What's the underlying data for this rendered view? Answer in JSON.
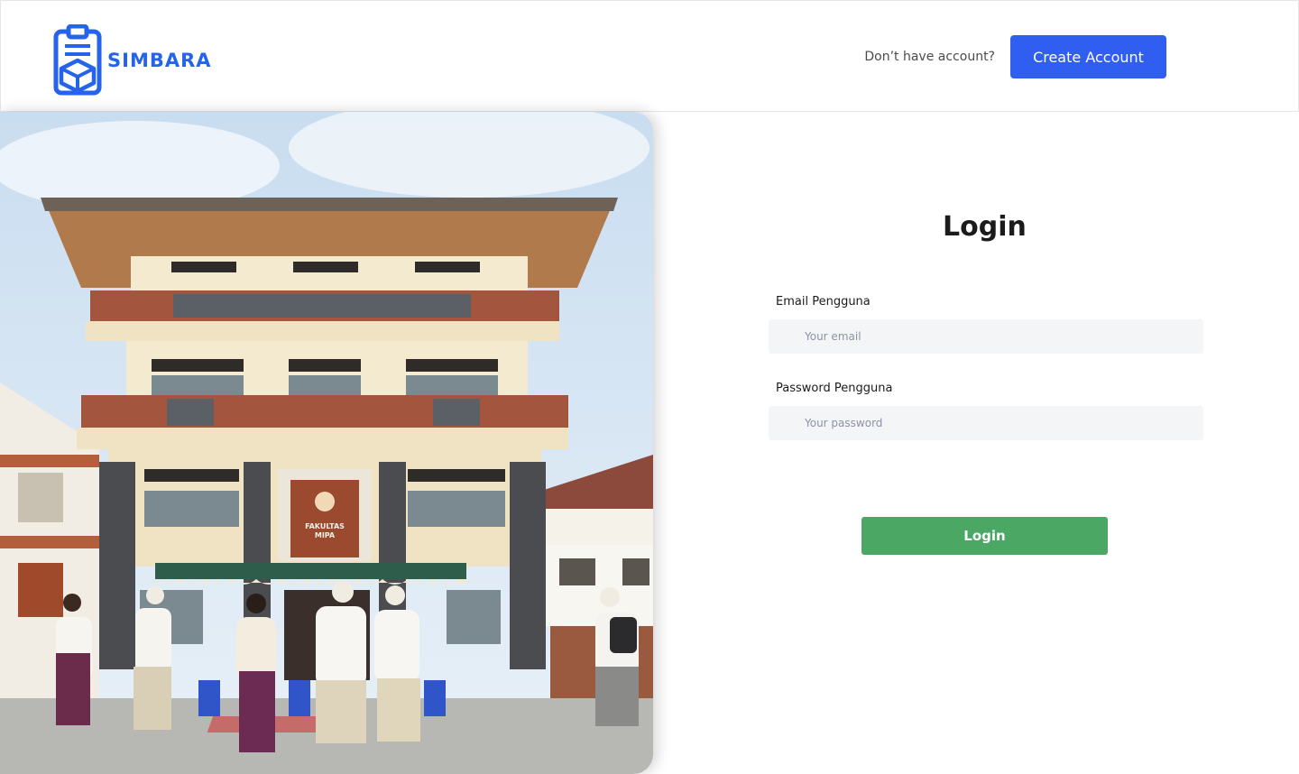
{
  "brand": {
    "name": "SIMBARA",
    "color": "#2563eb"
  },
  "header": {
    "no_account_text": "Don’t have account?",
    "create_account_label": "Create Account"
  },
  "photo": {
    "sign_line1": "FAKULTAS",
    "sign_line2": "MIPA"
  },
  "login": {
    "title": "Login",
    "email_label": "Email Pengguna",
    "email_placeholder": "Your email",
    "email_value": "",
    "password_label": "Password Pengguna",
    "password_placeholder": "Your password",
    "password_value": "",
    "submit_label": "Login"
  },
  "colors": {
    "primary": "#2f5ef0",
    "success": "#4aa764",
    "input_bg": "#f4f5f7"
  }
}
